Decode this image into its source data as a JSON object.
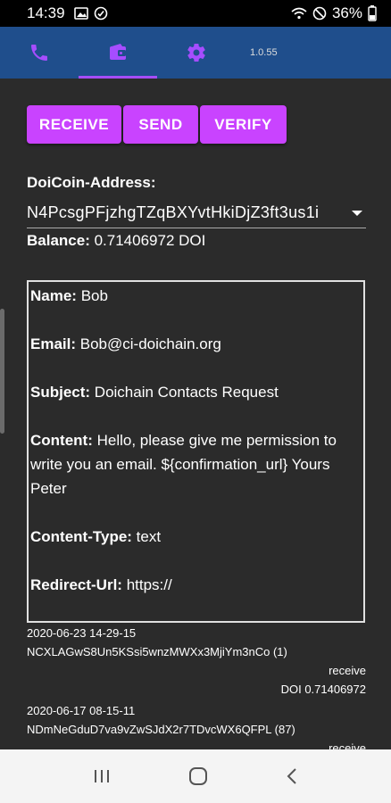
{
  "status_bar": {
    "time": "14:39",
    "battery": "36%"
  },
  "app_bar": {
    "tabs": [
      {
        "icon": "phone-icon"
      },
      {
        "icon": "wallet-icon"
      },
      {
        "icon": "gear-icon"
      }
    ],
    "version": "1.0.55",
    "accent": "#a64dff",
    "background": "#1f4e8c"
  },
  "actions": {
    "receive_label": "RECEIVE",
    "send_label": "SEND",
    "verify_label": "VERIFY",
    "color": "#c943ff"
  },
  "wallet": {
    "address_label": "DoiCoin-Address:",
    "address_value": "N4PcsgPFjzhgTZqBXYvtHkiDjZ3ft3us1i",
    "balance_label": "Balance:",
    "balance_value": " 0.71406972 DOI"
  },
  "details": {
    "name_label": "Name:",
    "name_value": " Bob",
    "email_label": "Email:",
    "email_value": " Bob@ci-doichain.org",
    "subject_label": "Subject:",
    "subject_value": " Doichain Contacts Request",
    "content_label": "Content:",
    "content_value": " Hello, please give me permission to write you an email. ${confirmation_url} Yours Peter",
    "content_type_label": "Content-Type:",
    "content_type_value": " text",
    "redirect_label": "Redirect-Url:",
    "redirect_value": " https://"
  },
  "transactions": [
    {
      "date": "2020-06-23 14-29-15",
      "txid": "NCXLAGwS8Un5KSsi5wnzMWXx3MjiYm3nCo (1)",
      "type": "receive",
      "amount": "DOI 0.71406972"
    },
    {
      "date": "2020-06-17 08-15-11",
      "txid": "NDmNeGduD7va9vZwSJdX2r7TDvcWX6QFPL (87)",
      "type": "receive",
      "amount": ""
    }
  ]
}
